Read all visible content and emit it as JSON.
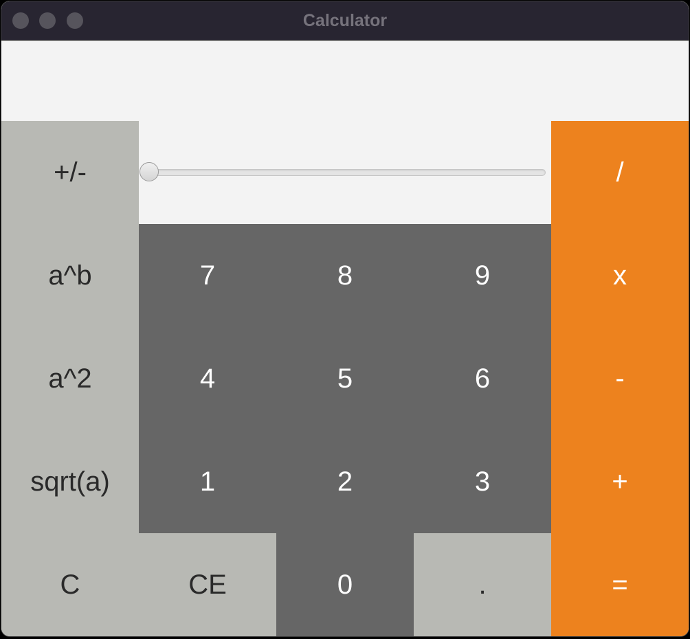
{
  "window": {
    "title": "Calculator"
  },
  "display": {
    "value": ""
  },
  "slider": {
    "value": 0
  },
  "buttons": {
    "negate": "+/-",
    "power": "a^b",
    "square": "a^2",
    "sqrt": "sqrt(a)",
    "clear": "C",
    "clear_entry": "CE",
    "decimal": ".",
    "digit_0": "0",
    "digit_1": "1",
    "digit_2": "2",
    "digit_3": "3",
    "digit_4": "4",
    "digit_5": "5",
    "digit_6": "6",
    "digit_7": "7",
    "digit_8": "8",
    "digit_9": "9",
    "divide": "/",
    "multiply": "x",
    "subtract": "-",
    "add": "+",
    "equals": "="
  },
  "colors": {
    "titlebar": "#282531",
    "function_key": "#b8b9b4",
    "number_key": "#666666",
    "operator_key": "#ed821e",
    "display_bg": "#f3f3f3"
  }
}
